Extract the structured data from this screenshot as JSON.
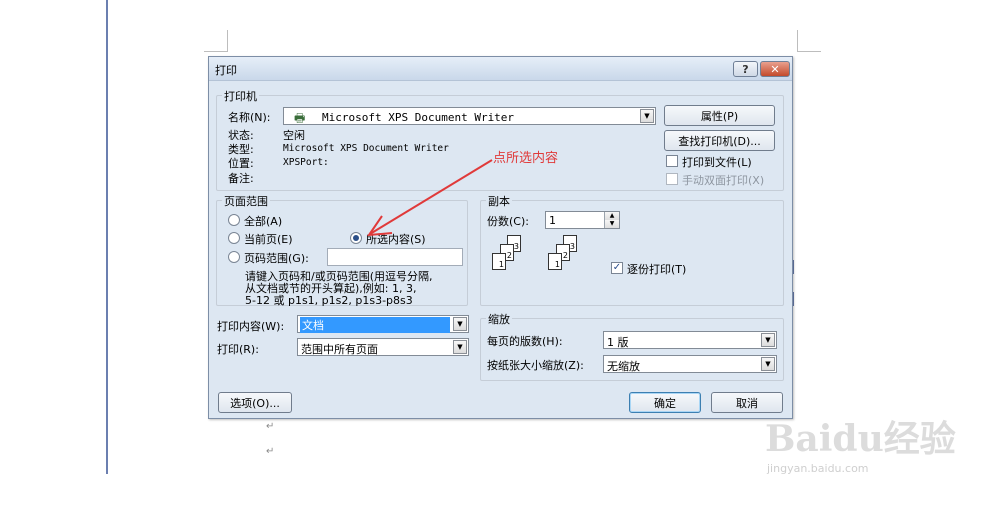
{
  "dialog": {
    "title": "打印"
  },
  "printer": {
    "group_label": "打印机",
    "name_label": "名称(N):",
    "name_value": "Microsoft XPS Document Writer",
    "status_label": "状态:",
    "status_value": "空闲",
    "type_label": "类型:",
    "type_value": "Microsoft XPS Document Writer",
    "where_label": "位置:",
    "where_value": "XPSPort:",
    "comment_label": "备注:",
    "properties_button": "属性(P)",
    "find_button": "查找打印机(D)...",
    "print_to_file": "打印到文件(L)",
    "manual_duplex": "手动双面打印(X)"
  },
  "page_range": {
    "group_label": "页面范围",
    "all": "全部(A)",
    "current": "当前页(E)",
    "selection": "所选内容(S)",
    "pages": "页码范围(G):",
    "hint_line1": "请键入页码和/或页码范围(用逗号分隔,",
    "hint_line2": "从文档或节的开头算起),例如: 1, 3,",
    "hint_line3": "5-12 或 p1s1, p1s2, p1s3-p8s3"
  },
  "copies": {
    "group_label": "副本",
    "count_label": "份数(C):",
    "count_value": "1",
    "collate": "逐份打印(T)",
    "page_labels": [
      "3",
      "2",
      "1"
    ]
  },
  "print_what": {
    "label": "打印内容(W):",
    "value": "文档"
  },
  "print": {
    "label": "打印(R):",
    "value": "范围中所有页面"
  },
  "zoom": {
    "group_label": "缩放",
    "pages_per_sheet_label": "每页的版数(H):",
    "pages_per_sheet_value": "1 版",
    "scale_label": "按纸张大小缩放(Z):",
    "scale_value": "无缩放"
  },
  "buttons": {
    "options": "选项(O)...",
    "ok": "确定",
    "cancel": "取消"
  },
  "annotation": "点所选内容",
  "watermark": {
    "brand": "Baidu经验",
    "url": "jingyan.baidu.com"
  },
  "colors": {
    "annotation": "#e03a3a",
    "selection_highlight": "#3399ff",
    "close_button": "#c34a2b"
  }
}
